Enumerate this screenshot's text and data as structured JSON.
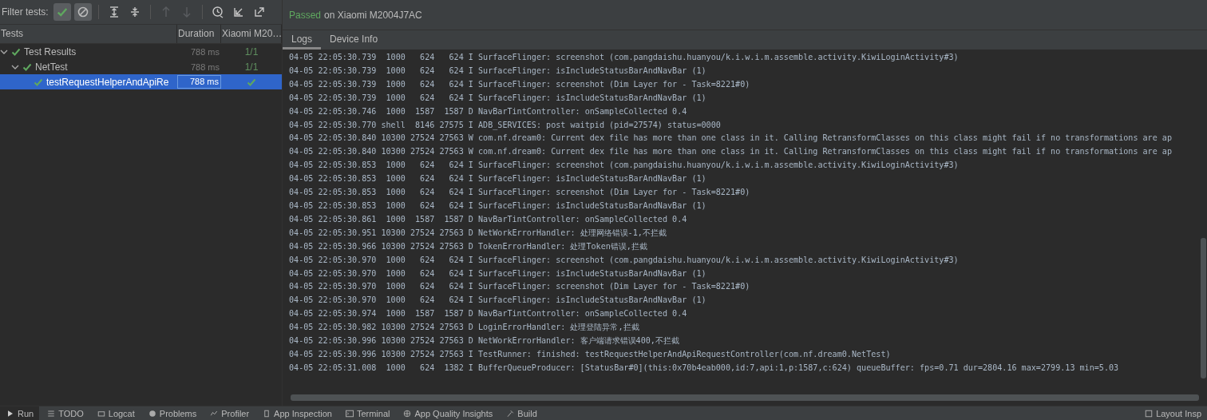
{
  "toolbar": {
    "label": "Filter tests:",
    "filters": [
      {
        "kind": "passed",
        "selected": true
      },
      {
        "kind": "ignored",
        "selected": true
      }
    ],
    "actions": [
      {
        "kind": "expand",
        "disabled": false
      },
      {
        "kind": "collapse",
        "disabled": false
      },
      {
        "kind": "up",
        "disabled": true
      },
      {
        "kind": "down",
        "disabled": true
      },
      {
        "kind": "history",
        "disabled": false
      },
      {
        "kind": "import",
        "disabled": false
      },
      {
        "kind": "export",
        "disabled": false
      }
    ]
  },
  "tree": {
    "columns": [
      "Tests",
      "Duration",
      "Xiaomi M20…"
    ],
    "nodes": [
      {
        "name": "Test Results",
        "duration": "788 ms",
        "result": "1/1",
        "passed": true,
        "expanded": true,
        "selected": false,
        "children": [
          {
            "name": "NetTest",
            "duration": "788 ms",
            "result": "1/1",
            "passed": true,
            "expanded": true,
            "selected": false,
            "children": [
              {
                "name": "testRequestHelperAndApiRe",
                "duration": "788 ms",
                "passed": true,
                "selected": true
              }
            ]
          }
        ]
      }
    ]
  },
  "details": {
    "status": "Passed",
    "device": "on Xiaomi M2004J7AC",
    "tabs": [
      {
        "label": "Logs",
        "selected": true
      },
      {
        "label": "Device Info",
        "selected": false
      }
    ],
    "log": [
      "04-05 22:05:30.739  1000   624   624 I SurfaceFlinger: screenshot (com.pangdaishu.huanyou/k.i.w.i.m.assemble.activity.KiwiLoginActivity#3)",
      "04-05 22:05:30.739  1000   624   624 I SurfaceFlinger: isIncludeStatusBarAndNavBar (1)",
      "04-05 22:05:30.739  1000   624   624 I SurfaceFlinger: screenshot (Dim Layer for - Task=8221#0)",
      "04-05 22:05:30.739  1000   624   624 I SurfaceFlinger: isIncludeStatusBarAndNavBar (1)",
      "04-05 22:05:30.746  1000  1587  1587 D NavBarTintController: onSampleCollected 0.4",
      "04-05 22:05:30.770 shell  8146 27575 I ADB_SERVICES: post waitpid (pid=27574) status=0000",
      "04-05 22:05:30.840 10300 27524 27563 W com.nf.dream0: Current dex file has more than one class in it. Calling RetransformClasses on this class might fail if no transformations are ap",
      "04-05 22:05:30.840 10300 27524 27563 W com.nf.dream0: Current dex file has more than one class in it. Calling RetransformClasses on this class might fail if no transformations are ap",
      "04-05 22:05:30.853  1000   624   624 I SurfaceFlinger: screenshot (com.pangdaishu.huanyou/k.i.w.i.m.assemble.activity.KiwiLoginActivity#3)",
      "04-05 22:05:30.853  1000   624   624 I SurfaceFlinger: isIncludeStatusBarAndNavBar (1)",
      "04-05 22:05:30.853  1000   624   624 I SurfaceFlinger: screenshot (Dim Layer for - Task=8221#0)",
      "04-05 22:05:30.853  1000   624   624 I SurfaceFlinger: isIncludeStatusBarAndNavBar (1)",
      "04-05 22:05:30.861  1000  1587  1587 D NavBarTintController: onSampleCollected 0.4",
      "04-05 22:05:30.951 10300 27524 27563 D NetWorkErrorHandler: 处理网络错误-1,不拦截",
      "04-05 22:05:30.966 10300 27524 27563 D TokenErrorHandler: 处理Token错误,拦截",
      "04-05 22:05:30.970  1000   624   624 I SurfaceFlinger: screenshot (com.pangdaishu.huanyou/k.i.w.i.m.assemble.activity.KiwiLoginActivity#3)",
      "04-05 22:05:30.970  1000   624   624 I SurfaceFlinger: isIncludeStatusBarAndNavBar (1)",
      "04-05 22:05:30.970  1000   624   624 I SurfaceFlinger: screenshot (Dim Layer for - Task=8221#0)",
      "04-05 22:05:30.970  1000   624   624 I SurfaceFlinger: isIncludeStatusBarAndNavBar (1)",
      "04-05 22:05:30.974  1000  1587  1587 D NavBarTintController: onSampleCollected 0.4",
      "04-05 22:05:30.982 10300 27524 27563 D LoginErrorHandler: 处理登陆异常,拦截",
      "04-05 22:05:30.996 10300 27524 27563 D NetWorkErrorHandler: 客户端请求错误400,不拦截",
      "04-05 22:05:30.996 10300 27524 27563 I TestRunner: finished: testRequestHelperAndApiRequestController(com.nf.dream0.NetTest)",
      "04-05 22:05:31.008  1000   624  1382 I BufferQueueProducer: [StatusBar#0](this:0x70b4eab000,id:7,api:1,p:1587,c:624) queueBuffer: fps=0.71 dur=2804.16 max=2799.13 min=5.03"
    ]
  },
  "bottom_bar": {
    "tabs": [
      {
        "kind": "run",
        "label": "Run",
        "selected": true
      },
      {
        "kind": "list",
        "label": "TODO",
        "selected": false
      },
      {
        "kind": "logcat",
        "label": "Logcat",
        "selected": false
      },
      {
        "kind": "problems",
        "label": "Problems",
        "selected": false
      },
      {
        "kind": "profiler",
        "label": "Profiler",
        "selected": false
      },
      {
        "kind": "inspection",
        "label": "App Inspection",
        "selected": false
      },
      {
        "kind": "terminal",
        "label": "Terminal",
        "selected": false
      },
      {
        "kind": "quality",
        "label": "App Quality Insights",
        "selected": false
      },
      {
        "kind": "build",
        "label": "Build",
        "selected": false
      }
    ],
    "right_tab": {
      "kind": "layout",
      "label": "Layout Insp"
    }
  }
}
